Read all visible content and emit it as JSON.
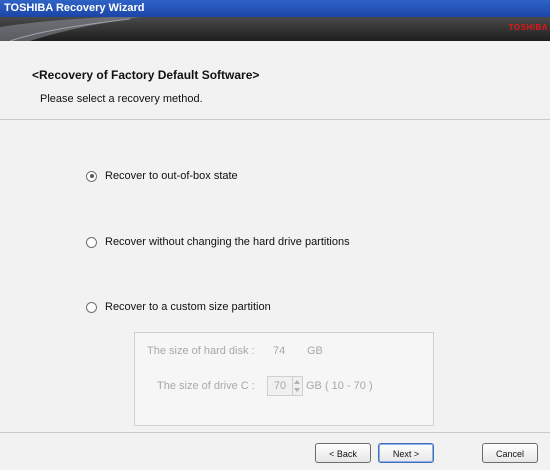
{
  "window": {
    "title": "TOSHIBA Recovery Wizard"
  },
  "banner": {
    "brand": "TOSHIBA"
  },
  "header": {
    "title": "<Recovery of Factory Default Software>",
    "subtitle": "Please select a recovery method."
  },
  "options": [
    {
      "label": "Recover to out-of-box state",
      "checked": true
    },
    {
      "label": "Recover without changing the hard drive partitions",
      "checked": false
    },
    {
      "label": "Recover to a custom size partition",
      "checked": false
    }
  ],
  "custom_partition": {
    "disk_size_label": "The size of hard disk :",
    "disk_size_value": "74",
    "disk_size_unit": "GB",
    "drive_c_label": "The size of drive C :",
    "drive_c_value": "70",
    "drive_c_range": "GB ( 10 - 70 )"
  },
  "footer": {
    "back_label": "< Back",
    "next_label": "Next >",
    "cancel_label": "Cancel"
  },
  "colors": {
    "titlebar": "#1b45a8",
    "brand": "#e01818",
    "disabled_text": "#a8a8a8"
  }
}
